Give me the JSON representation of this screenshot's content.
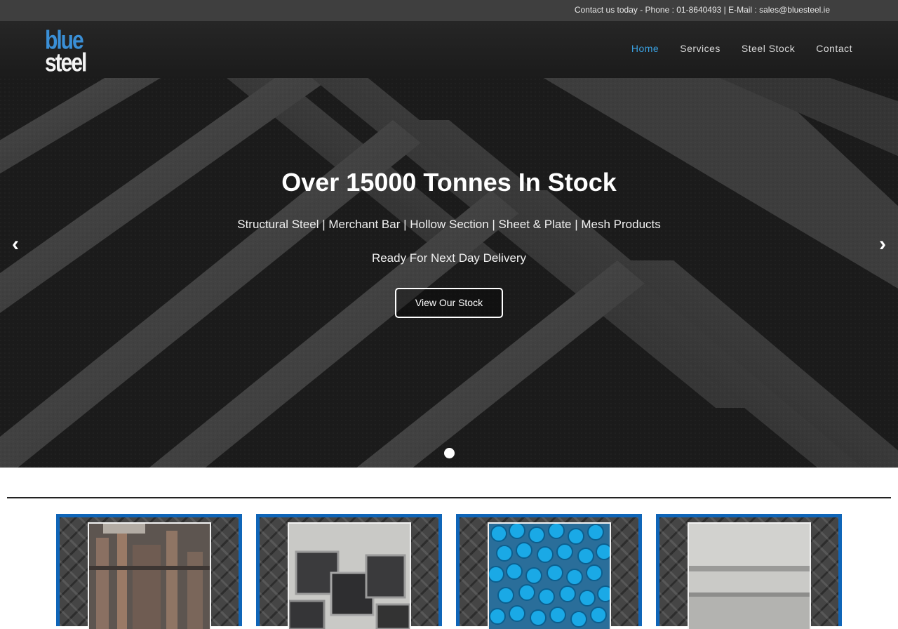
{
  "topbar": {
    "contact_text": "Contact us today - Phone : 01-8640493 | E-Mail : sales@bluesteel.ie"
  },
  "header": {
    "logo_top": "blue",
    "logo_bottom": "steel",
    "nav": [
      "Home",
      "Services",
      "Steel Stock",
      "Contact"
    ],
    "active_nav": "Home"
  },
  "hero": {
    "title": "Over 15000 Tonnes In Stock",
    "subtitle": "Structural Steel | Merchant Bar | Hollow Section | Sheet & Plate | Mesh Products",
    "delivery": "Ready For Next Day Delivery",
    "cta_label": "View Our Stock",
    "prev_icon": "chevron-left-icon",
    "next_icon": "chevron-right-icon",
    "slide_count": 1,
    "active_slide": 1
  },
  "colors": {
    "accent": "#3aa0e0",
    "tile_border": "#0f65b8",
    "topbar_bg": "#3f3f3f",
    "header_bg": "#1f1f1f"
  }
}
